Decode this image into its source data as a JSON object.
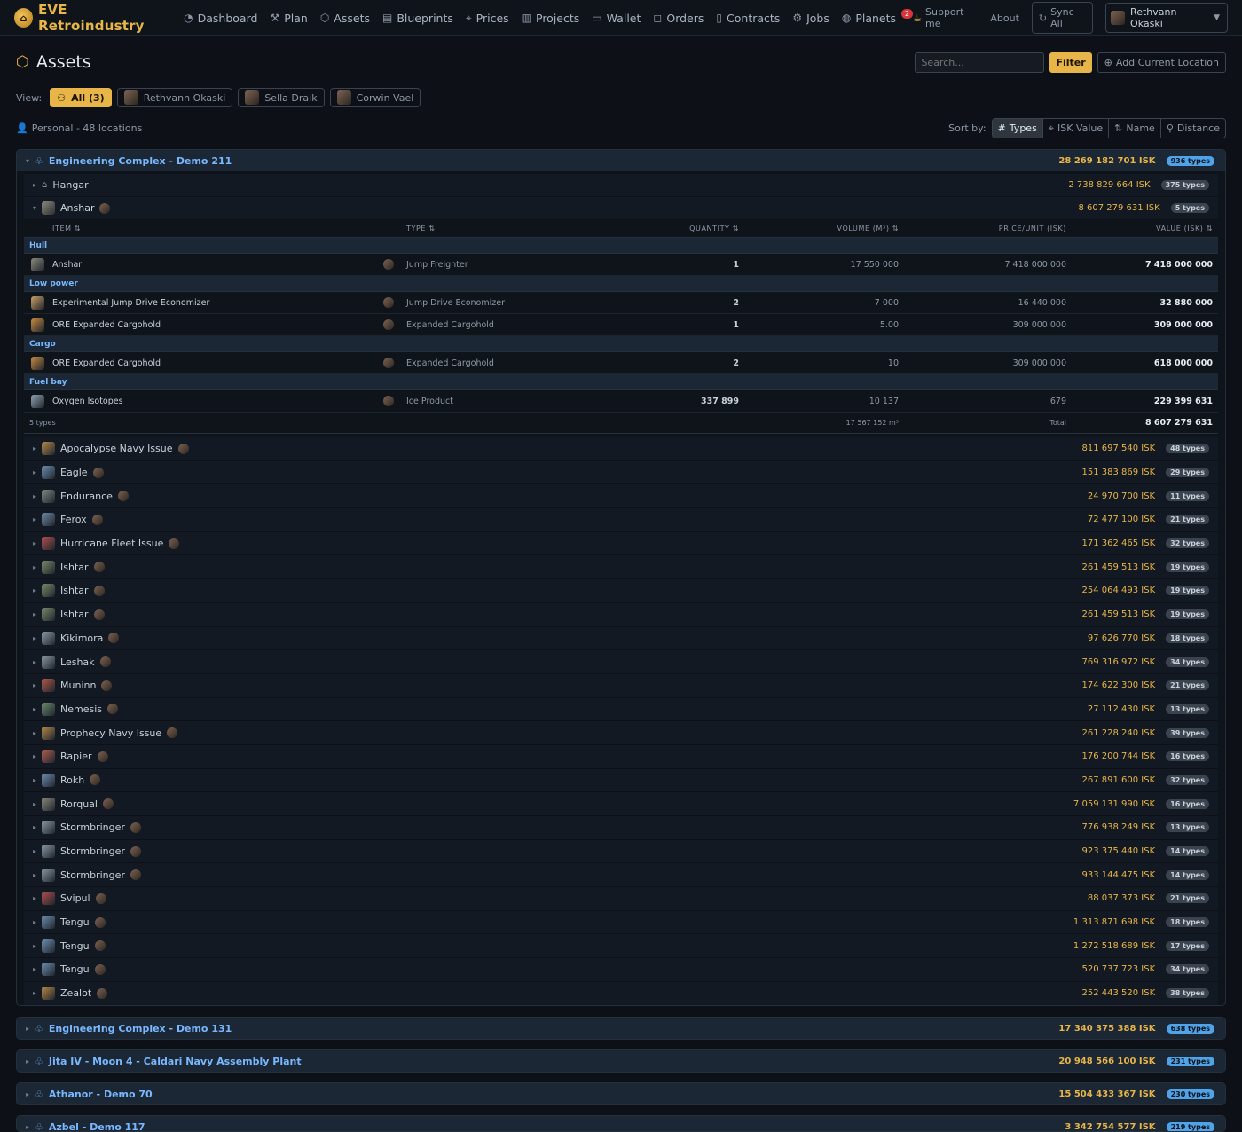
{
  "app": {
    "brand": "EVE Retroindustry",
    "nav": [
      {
        "label": "Dashboard",
        "icon": "gauge-icon"
      },
      {
        "label": "Plan",
        "icon": "hammer-icon"
      },
      {
        "label": "Assets",
        "icon": "box-icon"
      },
      {
        "label": "Blueprints",
        "icon": "document-icon"
      },
      {
        "label": "Prices",
        "icon": "tags-icon"
      },
      {
        "label": "Projects",
        "icon": "columns-icon"
      },
      {
        "label": "Wallet",
        "icon": "wallet-icon"
      },
      {
        "label": "Orders",
        "icon": "bag-icon"
      },
      {
        "label": "Contracts",
        "icon": "contract-icon"
      },
      {
        "label": "Jobs",
        "icon": "gear-icon"
      },
      {
        "label": "Planets",
        "icon": "globe-icon",
        "badge": "2"
      }
    ],
    "support_label": "Support me",
    "about_label": "About",
    "sync_label": "Sync All",
    "user_name": "Rethvann Okaski"
  },
  "page": {
    "title": "Assets",
    "search_placeholder": "Search...",
    "filter_label": "Filter",
    "add_location_label": "Add Current Location",
    "view_label": "View:",
    "views": [
      {
        "label": "All (3)",
        "active": true
      },
      {
        "label": "Rethvann Okaski",
        "active": false
      },
      {
        "label": "Sella Draik",
        "active": false
      },
      {
        "label": "Corwin Vael",
        "active": false
      }
    ],
    "summary": "Personal - 48 locations",
    "sort_label": "Sort by:",
    "sort_options": [
      {
        "label": "Types",
        "active": true
      },
      {
        "label": "ISK Value",
        "active": false
      },
      {
        "label": "Name",
        "active": false
      },
      {
        "label": "Distance",
        "active": false
      }
    ]
  },
  "main_location": {
    "name": "Engineering Complex - Demo 211",
    "value": "28 269 182 701 ISK",
    "types": "936 types",
    "hangar": {
      "name": "Hangar",
      "value": "2 738 829 664 ISK",
      "types": "375 types"
    },
    "anshar": {
      "name": "Anshar",
      "value": "8 607 279 631 ISK",
      "types": "5 types"
    },
    "table": {
      "headers": {
        "item": "ITEM",
        "type": "TYPE",
        "quantity": "QUANTITY",
        "volume": "VOLUME (M³)",
        "price": "PRICE/UNIT (ISK)",
        "value": "VALUE (ISK)"
      },
      "sections": [
        {
          "name": "Hull",
          "rows": [
            {
              "item": "Anshar",
              "type": "Jump Freighter",
              "qty": "1",
              "volume": "17 550 000",
              "price": "7 418 000 000",
              "value": "7 418 000 000",
              "color": "#8a8a7a"
            }
          ]
        },
        {
          "name": "Low power",
          "rows": [
            {
              "item": "Experimental Jump Drive Economizer",
              "type": "Jump Drive Economizer",
              "qty": "2",
              "volume": "7 000",
              "price": "16 440 000",
              "value": "32 880 000",
              "color": "#c9a064"
            },
            {
              "item": "ORE Expanded Cargohold",
              "type": "Expanded Cargohold",
              "qty": "1",
              "volume": "5.00",
              "price": "309 000 000",
              "value": "309 000 000",
              "color": "#c98a40"
            }
          ]
        },
        {
          "name": "Cargo",
          "rows": [
            {
              "item": "ORE Expanded Cargohold",
              "type": "Expanded Cargohold",
              "qty": "2",
              "volume": "10",
              "price": "309 000 000",
              "value": "618 000 000",
              "color": "#c98a40"
            }
          ]
        },
        {
          "name": "Fuel bay",
          "rows": [
            {
              "item": "Oxygen Isotopes",
              "type": "Ice Product",
              "qty": "337 899",
              "volume": "10 137",
              "price": "679",
              "value": "229 399 631",
              "color": "#8fa3b0"
            }
          ]
        }
      ],
      "footer": {
        "types": "5 types",
        "volume": "17 567 152 m³",
        "total_label": "Total",
        "total": "8 607 279 631"
      }
    },
    "ships": [
      {
        "name": "Apocalypse Navy Issue",
        "value": "811 697 540 ISK",
        "types": "48 types",
        "color": "#b58a4a"
      },
      {
        "name": "Eagle",
        "value": "151 383 869 ISK",
        "types": "29 types",
        "color": "#6d8fb0"
      },
      {
        "name": "Endurance",
        "value": "24 970 700 ISK",
        "types": "11 types",
        "color": "#7f8a80"
      },
      {
        "name": "Ferox",
        "value": "72 477 100 ISK",
        "types": "21 types",
        "color": "#6d88a5"
      },
      {
        "name": "Hurricane Fleet Issue",
        "value": "171 362 465 ISK",
        "types": "32 types",
        "color": "#b05050"
      },
      {
        "name": "Ishtar",
        "value": "261 459 513 ISK",
        "types": "19 types",
        "color": "#7a8a6a"
      },
      {
        "name": "Ishtar",
        "value": "254 064 493 ISK",
        "types": "19 types",
        "color": "#7a8a6a"
      },
      {
        "name": "Ishtar",
        "value": "261 459 513 ISK",
        "types": "19 types",
        "color": "#7a8a6a"
      },
      {
        "name": "Kikimora",
        "value": "97 626 770 ISK",
        "types": "18 types",
        "color": "#8a9aa5"
      },
      {
        "name": "Leshak",
        "value": "769 316 972 ISK",
        "types": "34 types",
        "color": "#8a9aa5"
      },
      {
        "name": "Muninn",
        "value": "174 622 300 ISK",
        "types": "21 types",
        "color": "#b05a4a"
      },
      {
        "name": "Nemesis",
        "value": "27 112 430 ISK",
        "types": "13 types",
        "color": "#6a8a70"
      },
      {
        "name": "Prophecy Navy Issue",
        "value": "261 228 240 ISK",
        "types": "39 types",
        "color": "#b58a4a"
      },
      {
        "name": "Rapier",
        "value": "176 200 744 ISK",
        "types": "16 types",
        "color": "#b06050"
      },
      {
        "name": "Rokh",
        "value": "267 891 600 ISK",
        "types": "32 types",
        "color": "#6d8fb0"
      },
      {
        "name": "Rorqual",
        "value": "7 059 131 990 ISK",
        "types": "16 types",
        "color": "#8a8a7a"
      },
      {
        "name": "Stormbringer",
        "value": "776 938 249 ISK",
        "types": "13 types",
        "color": "#8a9aa5"
      },
      {
        "name": "Stormbringer",
        "value": "923 375 440 ISK",
        "types": "14 types",
        "color": "#8a9aa5"
      },
      {
        "name": "Stormbringer",
        "value": "933 144 475 ISK",
        "types": "14 types",
        "color": "#8a9aa5"
      },
      {
        "name": "Svipul",
        "value": "88 037 373 ISK",
        "types": "21 types",
        "color": "#b05050"
      },
      {
        "name": "Tengu",
        "value": "1 313 871 698 ISK",
        "types": "18 types",
        "color": "#6d8fb0"
      },
      {
        "name": "Tengu",
        "value": "1 272 518 689 ISK",
        "types": "17 types",
        "color": "#6d8fb0"
      },
      {
        "name": "Tengu",
        "value": "520 737 723 ISK",
        "types": "34 types",
        "color": "#6d8fb0"
      },
      {
        "name": "Zealot",
        "value": "252 443 520 ISK",
        "types": "38 types",
        "color": "#b58a4a"
      }
    ]
  },
  "other_locations": [
    {
      "name": "Engineering Complex - Demo 131",
      "value": "17 340 375 388 ISK",
      "types": "638 types"
    },
    {
      "name": "Jita IV - Moon 4 - Caldari Navy Assembly Plant",
      "value": "20 948 566 100 ISK",
      "types": "231 types"
    },
    {
      "name": "Athanor - Demo 70",
      "value": "15 504 433 367 ISK",
      "types": "230 types"
    },
    {
      "name": "Azbel - Demo 117",
      "value": "3 342 754 577 ISK",
      "types": "219 types"
    }
  ]
}
